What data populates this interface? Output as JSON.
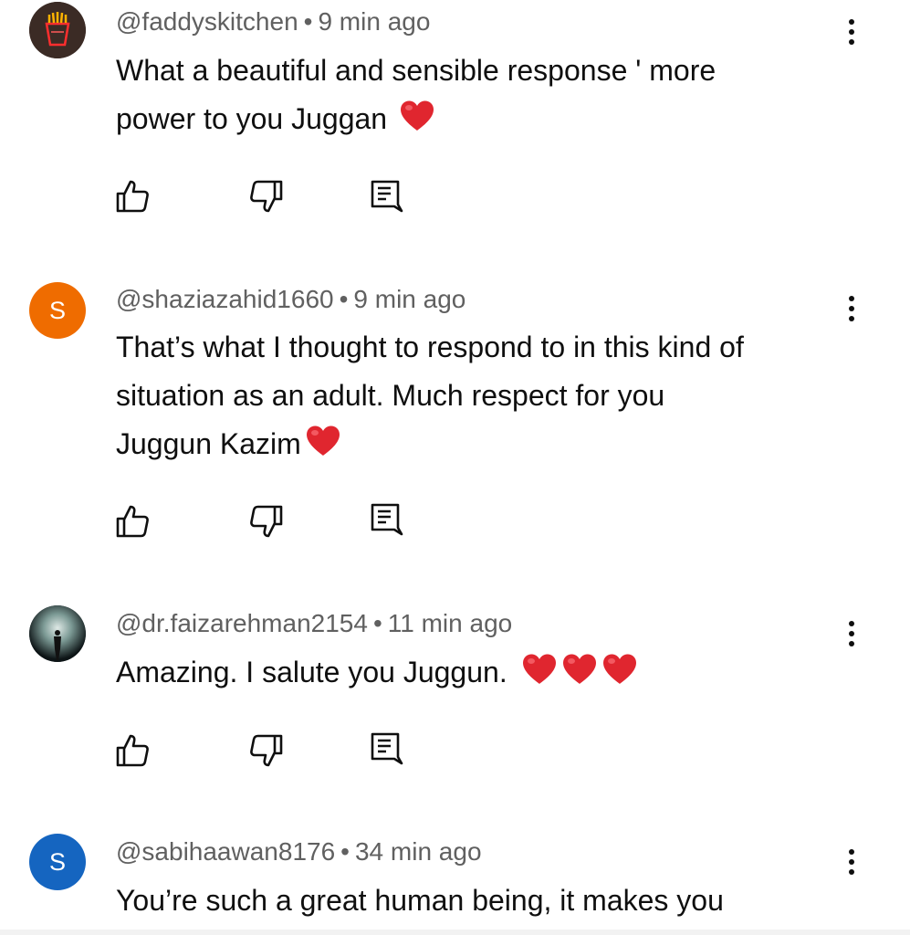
{
  "comments": [
    {
      "handle": "@faddyskitchen",
      "separator": "•",
      "time": "9 min ago",
      "avatar": {
        "type": "image",
        "icon": "fries-neon-logo",
        "bg": "#3b2b25"
      },
      "lines": [
        "What a beautiful and sensible response ' more",
        "power to you Juggan"
      ],
      "trailing_emoji": [
        "red-heart"
      ]
    },
    {
      "handle": "@shaziazahid1660",
      "separator": "•",
      "time": "9 min ago",
      "avatar": {
        "type": "letter",
        "letter": "S",
        "bg": "#ef6c00"
      },
      "lines": [
        "That’s what I thought to respond  to in this kind of",
        "situation as an adult. Much respect for you",
        "Juggun Kazim"
      ],
      "trailing_emoji": [
        "red-heart"
      ]
    },
    {
      "handle": "@dr.faizarehman2154",
      "separator": "•",
      "time": "11 min ago",
      "avatar": {
        "type": "image",
        "icon": "silhouette-photo",
        "bg": "#1d2a2e"
      },
      "lines": [
        "Amazing. I salute you Juggun."
      ],
      "trailing_emoji": [
        "red-heart",
        "red-heart",
        "red-heart"
      ]
    },
    {
      "handle": "@sabihaawan8176",
      "separator": "•",
      "time": "34 min ago",
      "avatar": {
        "type": "letter",
        "letter": "S",
        "bg": "#1565c0"
      },
      "lines": [
        "You’re such a great human being, it makes you"
      ],
      "trailing_emoji": []
    }
  ],
  "icons": {
    "like": "thumbs-up-icon",
    "dislike": "thumbs-down-icon",
    "reply": "reply-icon",
    "menu": "more-vert-icon"
  },
  "colors": {
    "text": "#0f0f0f",
    "meta": "#606060",
    "heart": "#e0262f"
  }
}
